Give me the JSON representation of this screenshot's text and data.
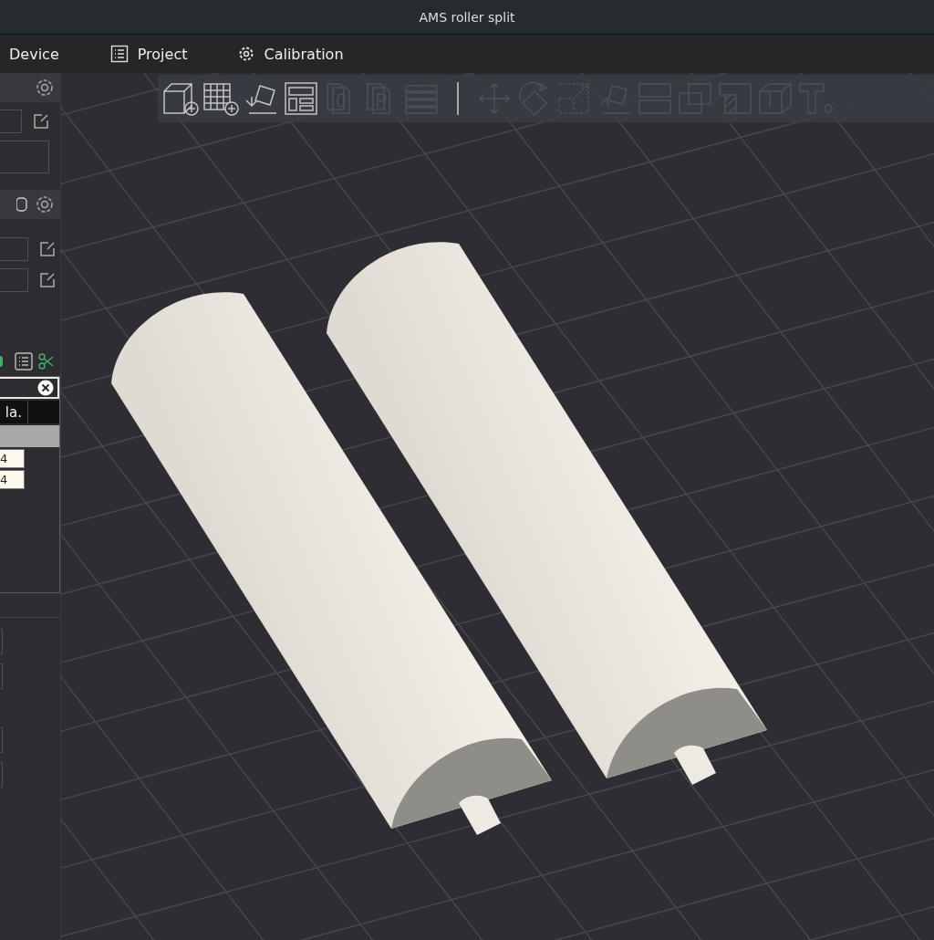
{
  "window": {
    "title": "AMS roller split"
  },
  "tabs": [
    {
      "label": "Device"
    },
    {
      "label": "Project"
    },
    {
      "label": "Calibration"
    }
  ],
  "toolbar": [
    {
      "kind": "add-cube",
      "disabled": false
    },
    {
      "kind": "add-plate",
      "disabled": false
    },
    {
      "kind": "auto-orient",
      "disabled": false
    },
    {
      "kind": "arrange",
      "disabled": false
    },
    {
      "kind": "copy",
      "disabled": true
    },
    {
      "kind": "page",
      "disabled": true
    },
    {
      "kind": "layers",
      "disabled": true
    },
    {
      "kind": "separator"
    },
    {
      "kind": "move",
      "disabled": true
    },
    {
      "kind": "rotate",
      "disabled": true
    },
    {
      "kind": "scale",
      "disabled": true
    },
    {
      "kind": "lay-flat",
      "disabled": true
    },
    {
      "kind": "split",
      "disabled": true
    },
    {
      "kind": "boolean",
      "disabled": true
    },
    {
      "kind": "support",
      "disabled": true
    },
    {
      "kind": "cut",
      "disabled": true
    },
    {
      "kind": "text",
      "disabled": true
    }
  ],
  "object_list": {
    "columns": [
      "la."
    ],
    "rows": [
      {
        "selected": true
      },
      {
        "value": "4",
        "selected": false
      },
      {
        "value": "4",
        "selected": false
      }
    ]
  }
}
